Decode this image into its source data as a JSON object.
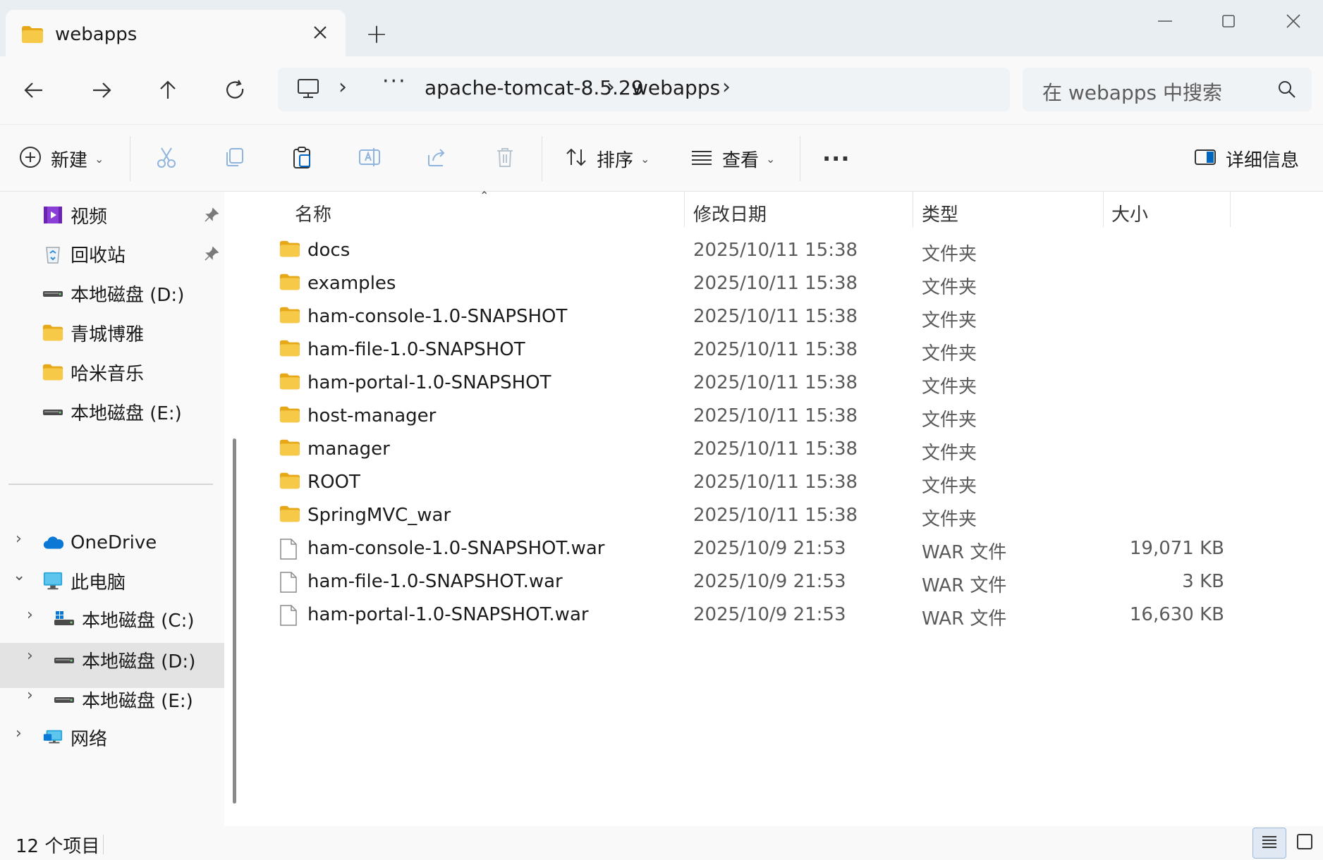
{
  "window": {
    "tab_title": "webapps",
    "new_tab": "+"
  },
  "address": {
    "more": "···",
    "crumbs": [
      "apache-tomcat-8.5.29",
      "webapps"
    ],
    "search_placeholder": "在 webapps 中搜索"
  },
  "commands": {
    "new_label": "新建",
    "sort_label": "排序",
    "view_label": "查看",
    "more_label": "···",
    "details_label": "详细信息"
  },
  "sidebar": {
    "quick_access": [
      {
        "label": "视频",
        "icon": "video-icon",
        "pinned": true
      },
      {
        "label": "回收站",
        "icon": "recycle-bin-icon",
        "pinned": true
      },
      {
        "label": "本地磁盘 (D:)",
        "icon": "drive-icon",
        "pinned": false
      },
      {
        "label": "青城博雅",
        "icon": "folder-icon",
        "pinned": false
      },
      {
        "label": "哈米音乐",
        "icon": "folder-icon",
        "pinned": false
      },
      {
        "label": "本地磁盘 (E:)",
        "icon": "drive-icon",
        "pinned": false
      }
    ],
    "tree": [
      {
        "label": "OneDrive",
        "icon": "onedrive-icon",
        "expander": "›"
      },
      {
        "label": "此电脑",
        "icon": "computer-icon",
        "expander": "⌄"
      },
      {
        "label": "本地磁盘 (C:)",
        "icon": "system-drive-icon",
        "expander": "›"
      },
      {
        "label": "本地磁盘 (D:)",
        "icon": "drive-icon",
        "expander": "›",
        "selected": true
      },
      {
        "label": "本地磁盘 (E:)",
        "icon": "drive-icon",
        "expander": "›"
      },
      {
        "label": "网络",
        "icon": "network-icon",
        "expander": "›"
      }
    ]
  },
  "columns": {
    "name": "名称",
    "modified": "修改日期",
    "type": "类型",
    "size": "大小"
  },
  "files": [
    {
      "name": "docs",
      "date": "2025/10/11 15:38",
      "type": "文件夹",
      "size": "",
      "kind": "folder"
    },
    {
      "name": "examples",
      "date": "2025/10/11 15:38",
      "type": "文件夹",
      "size": "",
      "kind": "folder"
    },
    {
      "name": "ham-console-1.0-SNAPSHOT",
      "date": "2025/10/11 15:38",
      "type": "文件夹",
      "size": "",
      "kind": "folder"
    },
    {
      "name": "ham-file-1.0-SNAPSHOT",
      "date": "2025/10/11 15:38",
      "type": "文件夹",
      "size": "",
      "kind": "folder"
    },
    {
      "name": "ham-portal-1.0-SNAPSHOT",
      "date": "2025/10/11 15:38",
      "type": "文件夹",
      "size": "",
      "kind": "folder"
    },
    {
      "name": "host-manager",
      "date": "2025/10/11 15:38",
      "type": "文件夹",
      "size": "",
      "kind": "folder"
    },
    {
      "name": "manager",
      "date": "2025/10/11 15:38",
      "type": "文件夹",
      "size": "",
      "kind": "folder"
    },
    {
      "name": "ROOT",
      "date": "2025/10/11 15:38",
      "type": "文件夹",
      "size": "",
      "kind": "folder"
    },
    {
      "name": "SpringMVC_war",
      "date": "2025/10/11 15:38",
      "type": "文件夹",
      "size": "",
      "kind": "folder"
    },
    {
      "name": "ham-console-1.0-SNAPSHOT.war",
      "date": "2025/10/9 21:53",
      "type": "WAR 文件",
      "size": "19,071 KB",
      "kind": "file"
    },
    {
      "name": "ham-file-1.0-SNAPSHOT.war",
      "date": "2025/10/9 21:53",
      "type": "WAR 文件",
      "size": "3 KB",
      "kind": "file"
    },
    {
      "name": "ham-portal-1.0-SNAPSHOT.war",
      "date": "2025/10/9 21:53",
      "type": "WAR 文件",
      "size": "16,630 KB",
      "kind": "file"
    }
  ],
  "status": {
    "item_count": "12 个项目"
  },
  "colors": {
    "folder": "#f7c948",
    "folder_dark": "#e6a817",
    "accent": "#0067c0",
    "selected": "#e3e3e3"
  }
}
